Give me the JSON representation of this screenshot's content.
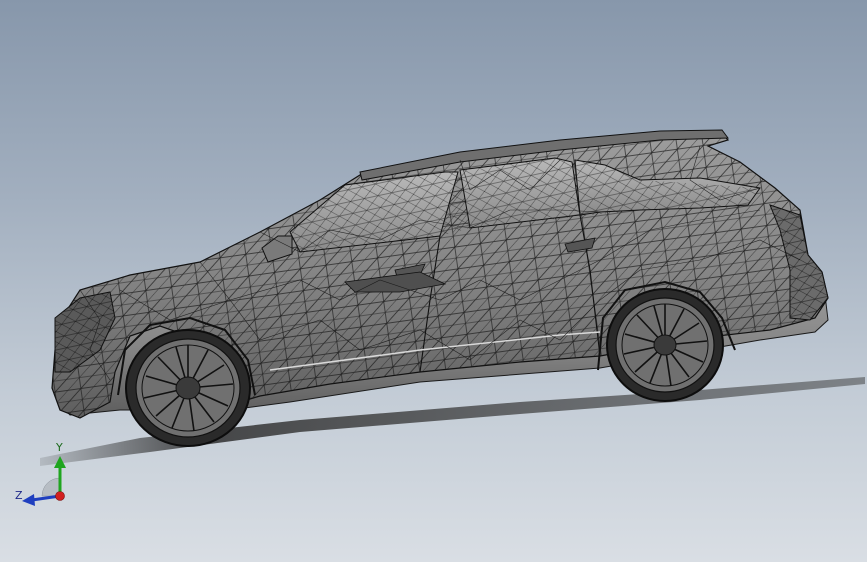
{
  "viewport": {
    "background_top": "#8797ab",
    "background_bottom": "#d9dee4",
    "model": "suv-wireframe-mesh",
    "render_style": "shaded-with-edges"
  },
  "triad": {
    "y_label": "Y",
    "z_label": "Z",
    "y_color": "#1fa51f",
    "z_color": "#1f3fbf",
    "x_color": "#d21f1f"
  }
}
